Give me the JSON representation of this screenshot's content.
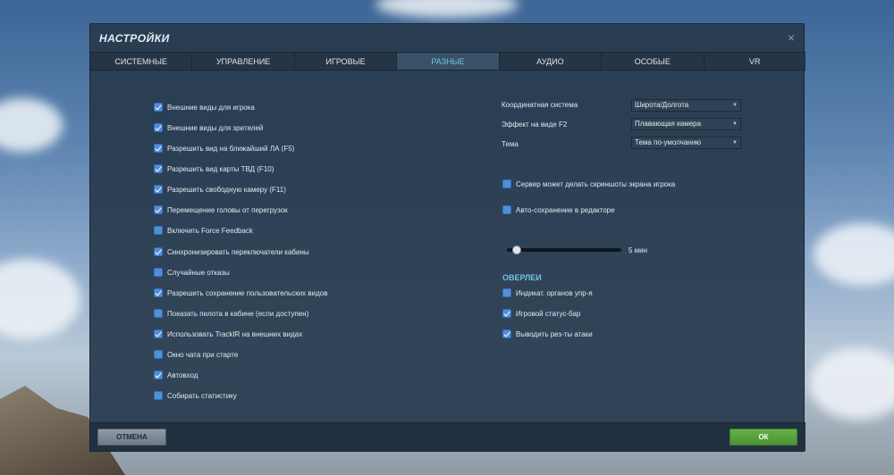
{
  "dialog": {
    "title": "НАСТРОЙКИ",
    "close_glyph": "×"
  },
  "tabs": [
    {
      "label": "СИСТЕМНЫЕ",
      "active": false
    },
    {
      "label": "УПРАВЛЕНИЕ",
      "active": false
    },
    {
      "label": "ИГРОВЫЕ",
      "active": false
    },
    {
      "label": "РАЗНЫЕ",
      "active": true
    },
    {
      "label": "АУДИО",
      "active": false
    },
    {
      "label": "ОСОБЫЕ",
      "active": false
    },
    {
      "label": "VR",
      "active": false
    }
  ],
  "left_options": [
    {
      "label": "Внешние виды для игрока",
      "checked": true
    },
    {
      "label": "Внешние виды для зрителей",
      "checked": true
    },
    {
      "label": "Разрешить вид на ближайший ЛА (F5)",
      "checked": true
    },
    {
      "label": "Разрешить вид карты ТВД (F10)",
      "checked": true
    },
    {
      "label": "Разрешить свободную камеру (F11)",
      "checked": true
    },
    {
      "label": "Перемещение головы от перегрузок",
      "checked": true
    },
    {
      "label": "Включить Force Feedback",
      "checked": false
    },
    {
      "label": "Синхронизировать переключатели кабины",
      "checked": true
    },
    {
      "label": "Случайные отказы",
      "checked": false
    },
    {
      "label": "Разрешить сохранение пользовательских видов",
      "checked": true
    },
    {
      "label": "Показать пилота в кабине (если доступен)",
      "checked": false
    },
    {
      "label": "Использовать TrackIR на внешних видах",
      "checked": true
    },
    {
      "label": "Окно чата при старте",
      "checked": false
    },
    {
      "label": "Автовход",
      "checked": true
    },
    {
      "label": "Собирать статистику",
      "checked": false
    }
  ],
  "settings": {
    "coord_label": "Координатная система",
    "coord_value": "Широта/Долгота",
    "f2_label": "Эффект на виде F2",
    "f2_value": "Плавающая камера",
    "theme_label": "Тема",
    "theme_value": "Тема по-умолчанию",
    "dropdown_glyph": "▼"
  },
  "right_options": [
    {
      "label": "Сервер может делать скриншоты экрана игрока",
      "checked": false
    },
    {
      "label": "Авто-сохранение в редакторе",
      "checked": false
    }
  ],
  "autosave_slider": {
    "value_label": "5 мин",
    "fraction": 0.05
  },
  "overlays": {
    "heading": "ОВЕРЛЕИ",
    "options": [
      {
        "label": "Индикат. органов упр-я",
        "checked": false
      },
      {
        "label": "Игровой статус-бар",
        "checked": true
      },
      {
        "label": "Выводить рез-ты атаки",
        "checked": true
      }
    ]
  },
  "footer": {
    "cancel_label": "ОТМЕНА",
    "ok_label": "ОК"
  },
  "colors": {
    "accent": "#6fc2e2",
    "checkbox": "#4f90d8",
    "ok_button": "#5aa33f"
  }
}
